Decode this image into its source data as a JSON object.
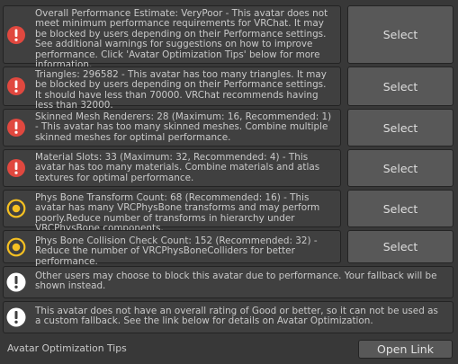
{
  "colors": {
    "error": "#e0483f",
    "warning": "#f5c022",
    "info": "#ffffff"
  },
  "warnings": [
    {
      "icon": "error-icon",
      "text": "Overall Performance Estimate: VeryPoor - This avatar does not meet minimum performance requirements for VRChat. It may be blocked by users depending on their Performance settings. See additional warnings for suggestions on how to improve performance. Click 'Avatar Optimization Tips' below for more information.",
      "button": "Select"
    },
    {
      "icon": "error-icon",
      "text": "Triangles: 296582 - This avatar has too many triangles. It may be blocked by users depending on their Performance settings. It should have less than 70000. VRChat recommends having less than 32000.",
      "button": "Select"
    },
    {
      "icon": "error-icon",
      "text": "Skinned Mesh Renderers: 28 (Maximum: 16, Recommended: 1) - This avatar has too many skinned meshes. Combine multiple skinned meshes for optimal performance.",
      "button": "Select"
    },
    {
      "icon": "error-icon",
      "text": "Material Slots: 33 (Maximum: 32, Recommended: 4) - This avatar has too many materials. Combine materials and atlas textures for optimal performance.",
      "button": "Select"
    },
    {
      "icon": "warning-icon",
      "text": "Phys Bone Transform Count: 68 (Recommended: 16) - This avatar has many VRCPhysBone transforms and may perform poorly.Reduce number of transforms in hierarchy under VRCPhysBone components.",
      "button": "Select"
    },
    {
      "icon": "warning-icon",
      "text": "Phys Bone Collision Check Count: 152 (Recommended: 32) - Reduce the number of VRCPhysBoneColliders for better performance.",
      "button": "Select"
    }
  ],
  "infos": [
    {
      "icon": "info-icon",
      "text": "Other users may choose to block this avatar due to performance. Your fallback will be shown instead."
    },
    {
      "icon": "info-icon",
      "text": "This avatar does not have an overall rating of Good or better, so it can not be used as a custom fallback. See the link below for details on Avatar Optimization."
    }
  ],
  "footer": {
    "label": "Avatar Optimization Tips",
    "button": "Open Link"
  }
}
